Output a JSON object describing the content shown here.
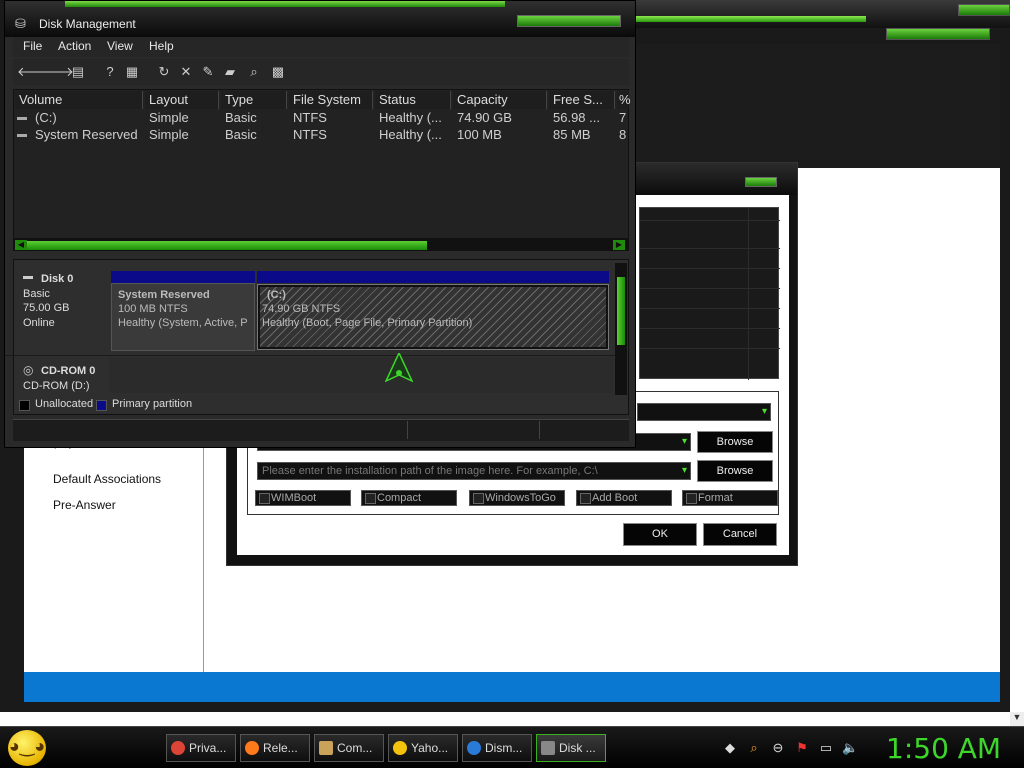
{
  "disk_mgmt": {
    "title": "Disk Management",
    "menu": [
      "File",
      "Action",
      "View",
      "Help"
    ],
    "columns": [
      "Volume",
      "Layout",
      "Type",
      "File System",
      "Status",
      "Capacity",
      "Free S...",
      "%"
    ],
    "rows": [
      [
        "(C:)",
        "Simple",
        "Basic",
        "NTFS",
        "Healthy (...",
        "74.90 GB",
        "56.98 ...",
        "7"
      ],
      [
        "System Reserved",
        "Simple",
        "Basic",
        "NTFS",
        "Healthy (...",
        "100 MB",
        "85 MB",
        "8"
      ]
    ],
    "disk0": {
      "name": "Disk 0",
      "type": "Basic",
      "size": "75.00 GB",
      "state": "Online"
    },
    "cdrom": {
      "name": "CD-ROM 0",
      "sub": "CD-ROM (D:)"
    },
    "part_sys": {
      "title": "System Reserved",
      "fs": "100 MB NTFS",
      "status": "Healthy (System, Active, P"
    },
    "part_c": {
      "title": "(C:)",
      "fs": "74.90 GB NTFS",
      "status": "Healthy (Boot, Page File, Primary Partition)"
    },
    "legend": {
      "unallocated": "Unallocated",
      "primary": "Primary partition"
    },
    "colors": {
      "primary": "#0b0b8a",
      "unallocated": "#000000",
      "accent": "#3dd62a"
    }
  },
  "dialog": {
    "path_placeholder": "Please enter the installation path of the image here. For example, C:\\",
    "browse1": "Browse",
    "browse2": "Browse",
    "options": [
      "WIMBoot",
      "Compact",
      "WindowsToGo",
      "Add Boot",
      "Format"
    ],
    "ok": "OK",
    "cancel": "Cancel"
  },
  "sidebar": {
    "cut_item": "Deploy Features",
    "items": [
      "Default Associations",
      "Pre-Answer"
    ]
  },
  "taskbar": {
    "tasks": [
      "Priva...",
      "Rele...",
      "Com...",
      "Yaho...",
      "Dism...",
      "Disk ..."
    ],
    "clock": "1:50 AM"
  }
}
